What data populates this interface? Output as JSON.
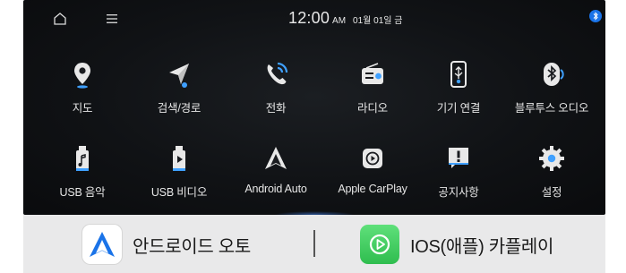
{
  "statusbar": {
    "time": "12:00",
    "ampm": "AM",
    "date": "01월 01일 금",
    "icons": [
      "home-icon",
      "menu-icon",
      "bluetooth-icon"
    ]
  },
  "apps": [
    {
      "label": "지도",
      "icon": "map-pin-icon"
    },
    {
      "label": "검색/경로",
      "icon": "navigation-arrow-icon"
    },
    {
      "label": "전화",
      "icon": "phone-icon"
    },
    {
      "label": "라디오",
      "icon": "radio-icon"
    },
    {
      "label": "기기 연결",
      "icon": "usb-phone-icon"
    },
    {
      "label": "블루투스 오디오",
      "icon": "bluetooth-audio-icon"
    },
    {
      "label": "USB 음악",
      "icon": "usb-music-icon"
    },
    {
      "label": "USB 비디오",
      "icon": "usb-video-icon"
    },
    {
      "label": "Android Auto",
      "icon": "android-auto-icon"
    },
    {
      "label": "Apple CarPlay",
      "icon": "carplay-icon"
    },
    {
      "label": "공지사항",
      "icon": "notice-icon"
    },
    {
      "label": "설정",
      "icon": "gear-icon"
    }
  ],
  "banner": {
    "left": {
      "label": "안드로이드 오토",
      "icon": "android-auto-logo-icon",
      "color": "#1a73e8"
    },
    "right": {
      "label": "IOS(애플) 카플레이",
      "icon": "carplay-logo-icon",
      "color": "#4cd964"
    }
  },
  "colors": {
    "icon_white": "#ffffff",
    "accent_blue": "#3fa0ff",
    "screen_bg": "#121417",
    "banner_bg": "#e9e9ea"
  }
}
